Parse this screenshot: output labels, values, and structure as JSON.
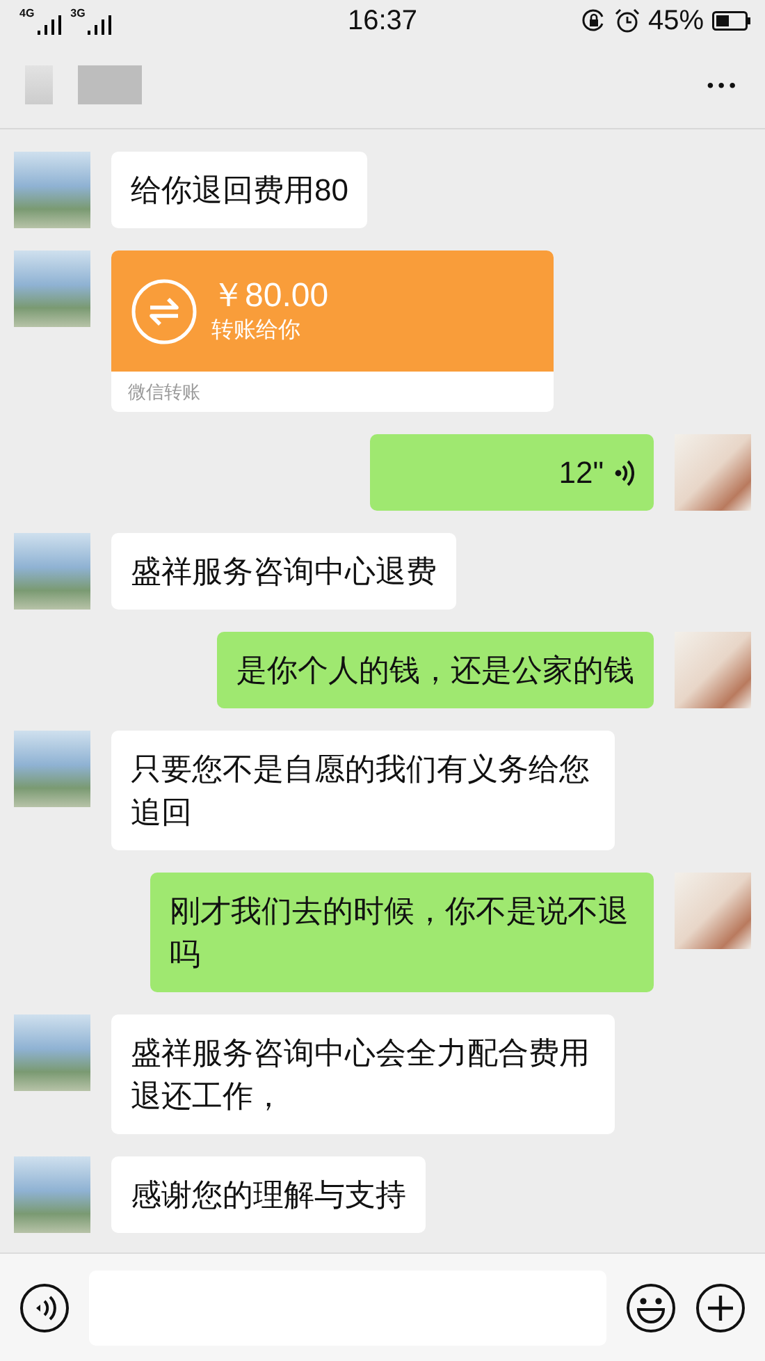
{
  "status_bar": {
    "network_1": "4G",
    "network_2": "3G",
    "time": "16:37",
    "battery": "45%"
  },
  "header": {
    "menu": "•••"
  },
  "messages": [
    {
      "kind": "text",
      "outgoing": false,
      "text": "给你退回费用80"
    },
    {
      "kind": "transfer",
      "outgoing": false,
      "amount": "￥80.00",
      "caption": "转账给你",
      "footer": "微信转账"
    },
    {
      "kind": "voice",
      "outgoing": true,
      "duration": "12\""
    },
    {
      "kind": "text",
      "outgoing": false,
      "text": "盛祥服务咨询中心退费"
    },
    {
      "kind": "text",
      "outgoing": true,
      "text": "是你个人的钱，还是公家的钱"
    },
    {
      "kind": "text",
      "outgoing": false,
      "text": "只要您不是自愿的我们有义务给您追回"
    },
    {
      "kind": "text",
      "outgoing": true,
      "text": "刚才我们去的时候，你不是说不退吗"
    },
    {
      "kind": "text",
      "outgoing": false,
      "text": "盛祥服务咨询中心会全力配合费用退还工作，"
    },
    {
      "kind": "text",
      "outgoing": false,
      "text": "感谢您的理解与支持"
    }
  ]
}
